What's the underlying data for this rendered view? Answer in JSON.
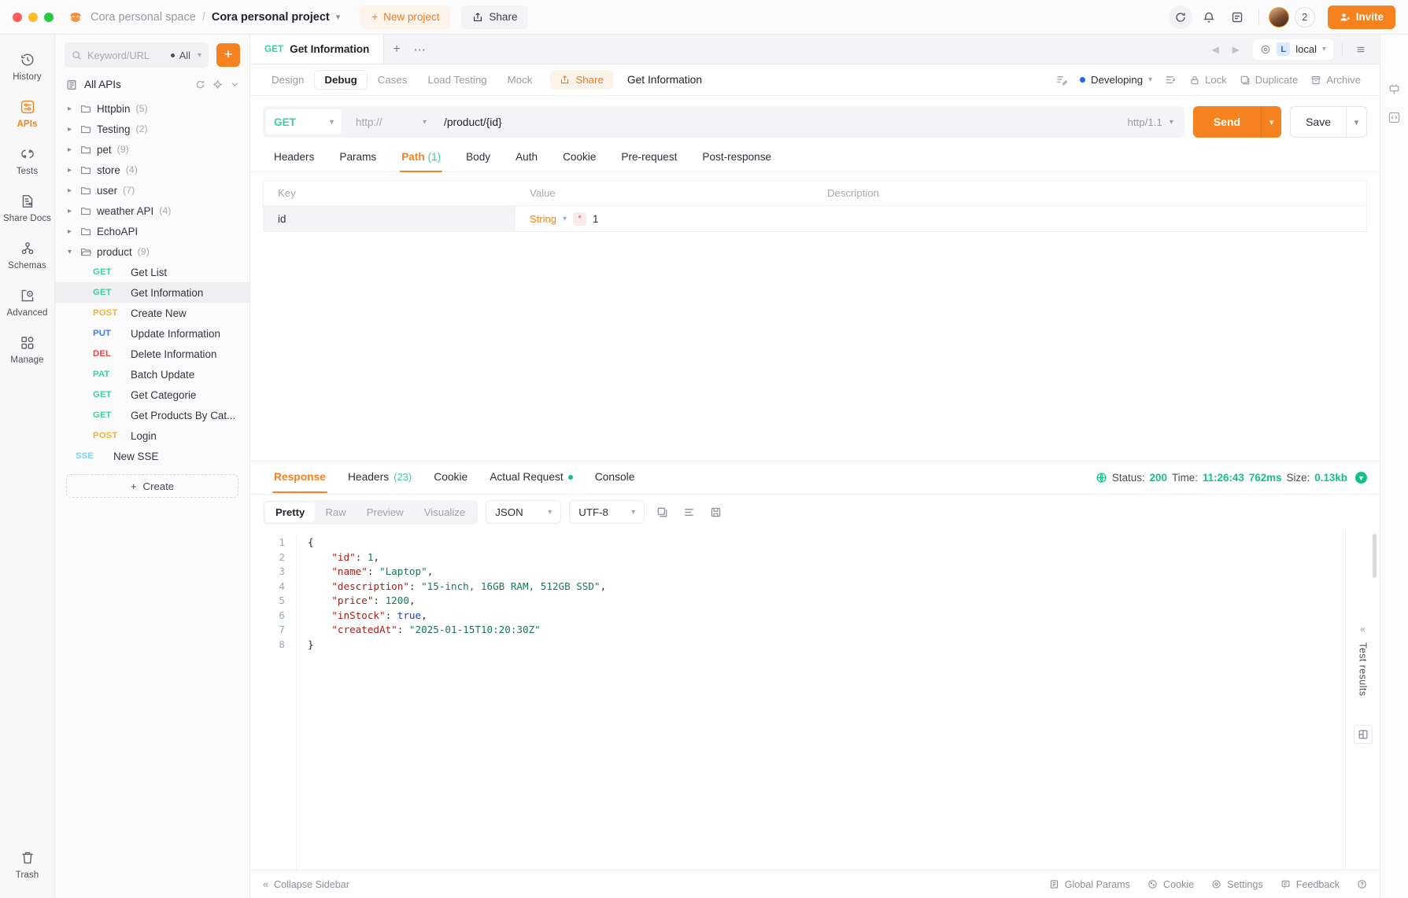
{
  "titlebar": {
    "space": "Cora personal space",
    "separator": "/",
    "project": "Cora personal project",
    "new_project": "New project",
    "share": "Share",
    "member_count": "2",
    "invite": "Invite"
  },
  "rail": {
    "items": [
      {
        "label": "History",
        "icon": "history-icon",
        "active": false
      },
      {
        "label": "APIs",
        "icon": "apis-icon",
        "active": true
      },
      {
        "label": "Tests",
        "icon": "tests-icon",
        "active": false
      },
      {
        "label": "Share Docs",
        "icon": "share-docs-icon",
        "active": false
      },
      {
        "label": "Schemas",
        "icon": "schemas-icon",
        "active": false
      },
      {
        "label": "Advanced",
        "icon": "advanced-icon",
        "active": false
      },
      {
        "label": "Manage",
        "icon": "manage-icon",
        "active": false
      }
    ],
    "trash": "Trash"
  },
  "sidebar": {
    "search_placeholder": "Keyword/URL",
    "scope": "All",
    "add_button": "+",
    "all_apis": "All APIs",
    "folders": [
      {
        "name": "Httpbin",
        "count": "(5)",
        "expanded": false
      },
      {
        "name": "Testing",
        "count": "(2)",
        "expanded": false
      },
      {
        "name": "pet",
        "count": "(9)",
        "expanded": false
      },
      {
        "name": "store",
        "count": "(4)",
        "expanded": false
      },
      {
        "name": "user",
        "count": "(7)",
        "expanded": false
      },
      {
        "name": "weather API",
        "count": "(4)",
        "expanded": false
      },
      {
        "name": "EchoAPI",
        "count": "",
        "expanded": false
      },
      {
        "name": "product",
        "count": "(9)",
        "expanded": true
      }
    ],
    "product_items": [
      {
        "method": "GET",
        "name": "Get List",
        "selected": false
      },
      {
        "method": "GET",
        "name": "Get Information",
        "selected": true
      },
      {
        "method": "POST",
        "name": "Create New",
        "selected": false
      },
      {
        "method": "PUT",
        "name": "Update Information",
        "selected": false
      },
      {
        "method": "DEL",
        "name": "Delete Information",
        "selected": false
      },
      {
        "method": "PAT",
        "name": "Batch Update",
        "selected": false
      },
      {
        "method": "GET",
        "name": "Get Categorie",
        "selected": false
      },
      {
        "method": "GET",
        "name": "Get Products By Cat...",
        "selected": false
      },
      {
        "method": "POST",
        "name": "Login",
        "selected": false
      },
      {
        "method": "SSE",
        "name": "New SSE",
        "selected": false
      }
    ],
    "create": "Create"
  },
  "tabstrip": {
    "doc_method": "GET",
    "doc_title": "Get Information",
    "plus": "+",
    "dots": "⋯",
    "env_badge": "L",
    "env_name": "local"
  },
  "subbar": {
    "tabs": [
      {
        "label": "Design",
        "active": false
      },
      {
        "label": "Debug",
        "active": true
      },
      {
        "label": "Cases",
        "active": false
      },
      {
        "label": "Load Testing",
        "active": false
      },
      {
        "label": "Mock",
        "active": false
      }
    ],
    "share": "Share",
    "request_name": "Get Information",
    "status": "Developing",
    "lock": "Lock",
    "duplicate": "Duplicate",
    "archive": "Archive"
  },
  "urlbar": {
    "method": "GET",
    "protocol": "http://",
    "path": "/product/{id}",
    "http_version": "http/1.1",
    "send": "Send",
    "save": "Save"
  },
  "param_tabs": [
    {
      "label": "Headers",
      "count": "",
      "active": false
    },
    {
      "label": "Params",
      "count": "",
      "active": false
    },
    {
      "label": "Path",
      "count": "(1)",
      "active": true
    },
    {
      "label": "Body",
      "count": "",
      "active": false
    },
    {
      "label": "Auth",
      "count": "",
      "active": false
    },
    {
      "label": "Cookie",
      "count": "",
      "active": false
    },
    {
      "label": "Pre-request",
      "count": "",
      "active": false
    },
    {
      "label": "Post-response",
      "count": "",
      "active": false
    }
  ],
  "param_table": {
    "headers": {
      "key": "Key",
      "value": "Value",
      "description": "Description"
    },
    "rows": [
      {
        "key": "id",
        "type": "String",
        "required": "*",
        "value": "1",
        "description": ""
      }
    ]
  },
  "response": {
    "tabs": [
      {
        "label": "Response",
        "count": "",
        "active": true,
        "dot": false
      },
      {
        "label": "Headers",
        "count": "(23)",
        "active": false,
        "dot": false
      },
      {
        "label": "Cookie",
        "count": "",
        "active": false,
        "dot": false
      },
      {
        "label": "Actual Request",
        "count": "",
        "active": false,
        "dot": true
      },
      {
        "label": "Console",
        "count": "",
        "active": false,
        "dot": false
      }
    ],
    "status_label": "Status:",
    "status_value": "200",
    "time_label": "Time:",
    "time_value": "11:26:43",
    "duration_value": "762ms",
    "size_label": "Size:",
    "size_value": "0.13kb",
    "view_modes": [
      {
        "label": "Pretty",
        "active": true
      },
      {
        "label": "Raw",
        "active": false
      },
      {
        "label": "Preview",
        "active": false
      },
      {
        "label": "Visualize",
        "active": false
      }
    ],
    "format": "JSON",
    "encoding": "UTF-8",
    "test_results": "Test results",
    "body_lines": [
      {
        "n": "1",
        "html": "{"
      },
      {
        "n": "2",
        "html": "    \"id\": 1,"
      },
      {
        "n": "3",
        "html": "    \"name\": \"Laptop\","
      },
      {
        "n": "4",
        "html": "    \"description\": \"15-inch, 16GB RAM, 512GB SSD\","
      },
      {
        "n": "5",
        "html": "    \"price\": 1200,"
      },
      {
        "n": "6",
        "html": "    \"inStock\": true,"
      },
      {
        "n": "7",
        "html": "    \"createdAt\": \"2025-01-15T10:20:30Z\""
      },
      {
        "n": "8",
        "html": "}"
      }
    ]
  },
  "footer": {
    "collapse": "Collapse Sidebar",
    "global_params": "Global Params",
    "cookie": "Cookie",
    "settings": "Settings",
    "feedback": "Feedback"
  },
  "colors": {
    "accent": "#f5821f",
    "get": "#3ccfa0",
    "post": "#f2b13b",
    "put": "#3c7ef0",
    "delete": "#ef4444",
    "sse": "#7fd3ee",
    "success": "#14c08a"
  }
}
